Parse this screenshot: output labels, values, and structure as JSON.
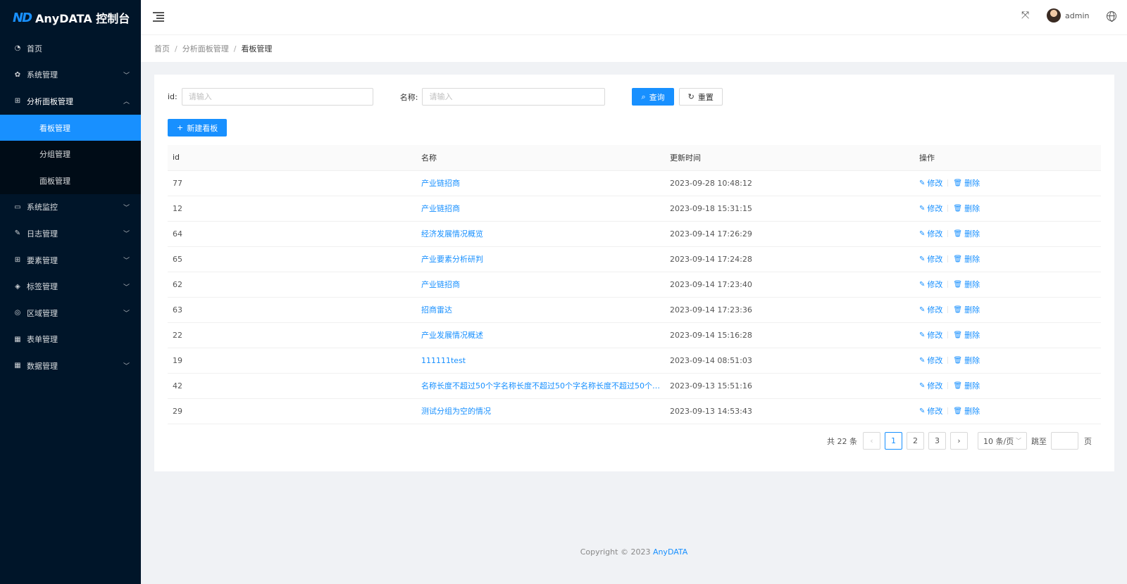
{
  "app": {
    "logo_mark": "ND",
    "title": "AnyDATA 控制台"
  },
  "sidebar": {
    "items": [
      {
        "label": "首页",
        "icon": "dashboard-icon"
      },
      {
        "label": "系统管理",
        "icon": "gear-icon"
      },
      {
        "label": "分析面板管理",
        "icon": "apps-icon"
      },
      {
        "label": "系统监控",
        "icon": "monitor-icon"
      },
      {
        "label": "日志管理",
        "icon": "edit-doc-icon"
      },
      {
        "label": "要素管理",
        "icon": "grid-icon"
      },
      {
        "label": "标签管理",
        "icon": "tag-icon"
      },
      {
        "label": "区域管理",
        "icon": "location-icon"
      },
      {
        "label": "表单管理",
        "icon": "table-icon"
      },
      {
        "label": "数据管理",
        "icon": "table-icon"
      }
    ],
    "submenu": [
      {
        "label": "看板管理"
      },
      {
        "label": "分组管理"
      },
      {
        "label": "面板管理"
      }
    ]
  },
  "header": {
    "username": "admin"
  },
  "breadcrumb": {
    "home": "首页",
    "parent": "分析面板管理",
    "current": "看板管理"
  },
  "search": {
    "id_label": "id:",
    "id_placeholder": "请输入",
    "name_label": "名称:",
    "name_placeholder": "请输入",
    "query_label": "查询",
    "reset_label": "重置"
  },
  "toolbar": {
    "new_label": "新建看板"
  },
  "table": {
    "headers": {
      "id": "id",
      "name": "名称",
      "time": "更新时间",
      "op": "操作"
    },
    "edit_label": "修改",
    "delete_label": "删除",
    "rows": [
      {
        "id": "77",
        "name": "产业链招商",
        "time": "2023-09-28 10:48:12"
      },
      {
        "id": "12",
        "name": "产业链招商",
        "time": "2023-09-18 15:31:15"
      },
      {
        "id": "64",
        "name": "经济发展情况概览",
        "time": "2023-09-14 17:26:29"
      },
      {
        "id": "65",
        "name": "产业要素分析研判",
        "time": "2023-09-14 17:24:28"
      },
      {
        "id": "62",
        "name": "产业链招商",
        "time": "2023-09-14 17:23:40"
      },
      {
        "id": "63",
        "name": "招商雷达",
        "time": "2023-09-14 17:23:36"
      },
      {
        "id": "22",
        "name": "产业发展情况概述",
        "time": "2023-09-14 15:16:28"
      },
      {
        "id": "19",
        "name": "111111test",
        "time": "2023-09-14 08:51:03"
      },
      {
        "id": "42",
        "name": "名称长度不超过50个字名称长度不超过50个字名称长度不超过50个字...",
        "time": "2023-09-13 15:51:16"
      },
      {
        "id": "29",
        "name": "测试分组为空的情况",
        "time": "2023-09-13 14:53:43"
      }
    ]
  },
  "pagination": {
    "total": "共 22 条",
    "pages": [
      "1",
      "2",
      "3"
    ],
    "page_size": "10 条/页",
    "jump_label": "跳至",
    "page_suffix": "页"
  },
  "footer": {
    "copyright": "Copyright © 2023 ",
    "brand": "AnyDATA"
  },
  "colors": {
    "sidebar_bg": "#001529",
    "accent": "#1890ff"
  }
}
